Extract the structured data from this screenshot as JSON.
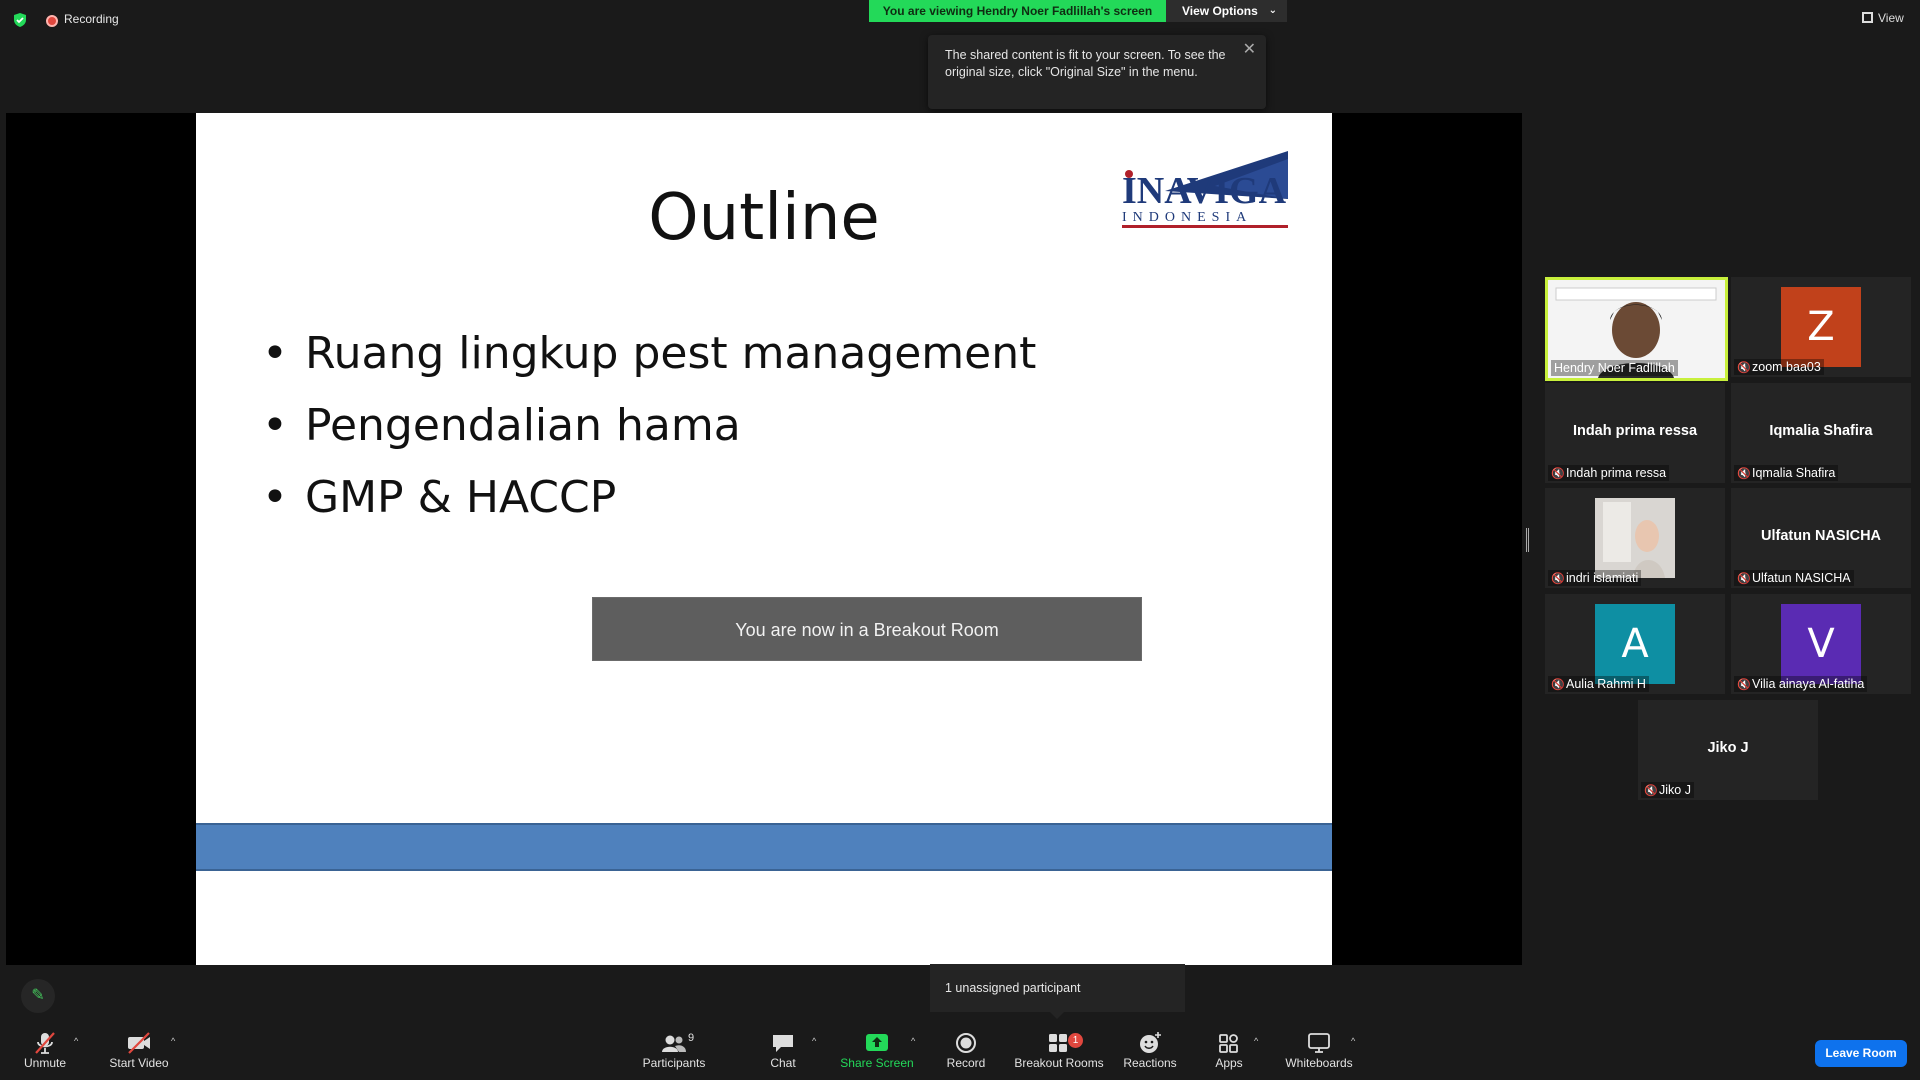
{
  "topbar": {
    "recording_label": "Recording",
    "viewing_banner": "You are viewing Hendry Noer Fadlillah's screen",
    "view_options_label": "View Options",
    "view_label": "View"
  },
  "tooltip": {
    "text": "The shared content is fit to your screen. To see the original size, click \"Original Size\" in the menu."
  },
  "slide": {
    "title": "Outline",
    "bullets": [
      "Ruang lingkup pest management",
      "Pengendalian hama",
      "GMP & HACCP"
    ],
    "logo_top": "INAVIGA",
    "logo_bottom": "INDONESIA",
    "band_color": "#4f81bd"
  },
  "breakout_toast": "You are now in a Breakout Room",
  "participants": [
    {
      "name": "Hendry Noer Fadlillah",
      "type": "video",
      "active": true
    },
    {
      "name": "zoom baa03",
      "type": "avatar",
      "initial": "Z",
      "color": "#c1411b"
    },
    {
      "name": "Indah prima ressa",
      "type": "name"
    },
    {
      "name": "Iqmalia Shafira",
      "type": "name"
    },
    {
      "name": "indri islamiati",
      "type": "photo"
    },
    {
      "name": "Ulfatun NASICHA",
      "type": "name"
    },
    {
      "name": "Aulia Rahmi H",
      "type": "avatar",
      "initial": "A",
      "color": "#0e8fa3"
    },
    {
      "name": "Vilia ainaya Al-fatiha",
      "type": "avatar",
      "initial": "V",
      "color": "#5a2bb3"
    },
    {
      "name": "Jiko J",
      "type": "name"
    }
  ],
  "unassigned_tip": "1 unassigned participant",
  "toolbar": {
    "unmute": "Unmute",
    "start_video": "Start Video",
    "participants": "Participants",
    "participants_count": "9",
    "chat": "Chat",
    "share_screen": "Share Screen",
    "record": "Record",
    "breakout_rooms": "Breakout Rooms",
    "breakout_badge": "1",
    "reactions": "Reactions",
    "apps": "Apps",
    "whiteboards": "Whiteboards",
    "leave_room": "Leave Room"
  },
  "colors": {
    "banner_green": "#23d959",
    "leave_blue": "#0e72ed",
    "active_border": "#c8f03c"
  }
}
